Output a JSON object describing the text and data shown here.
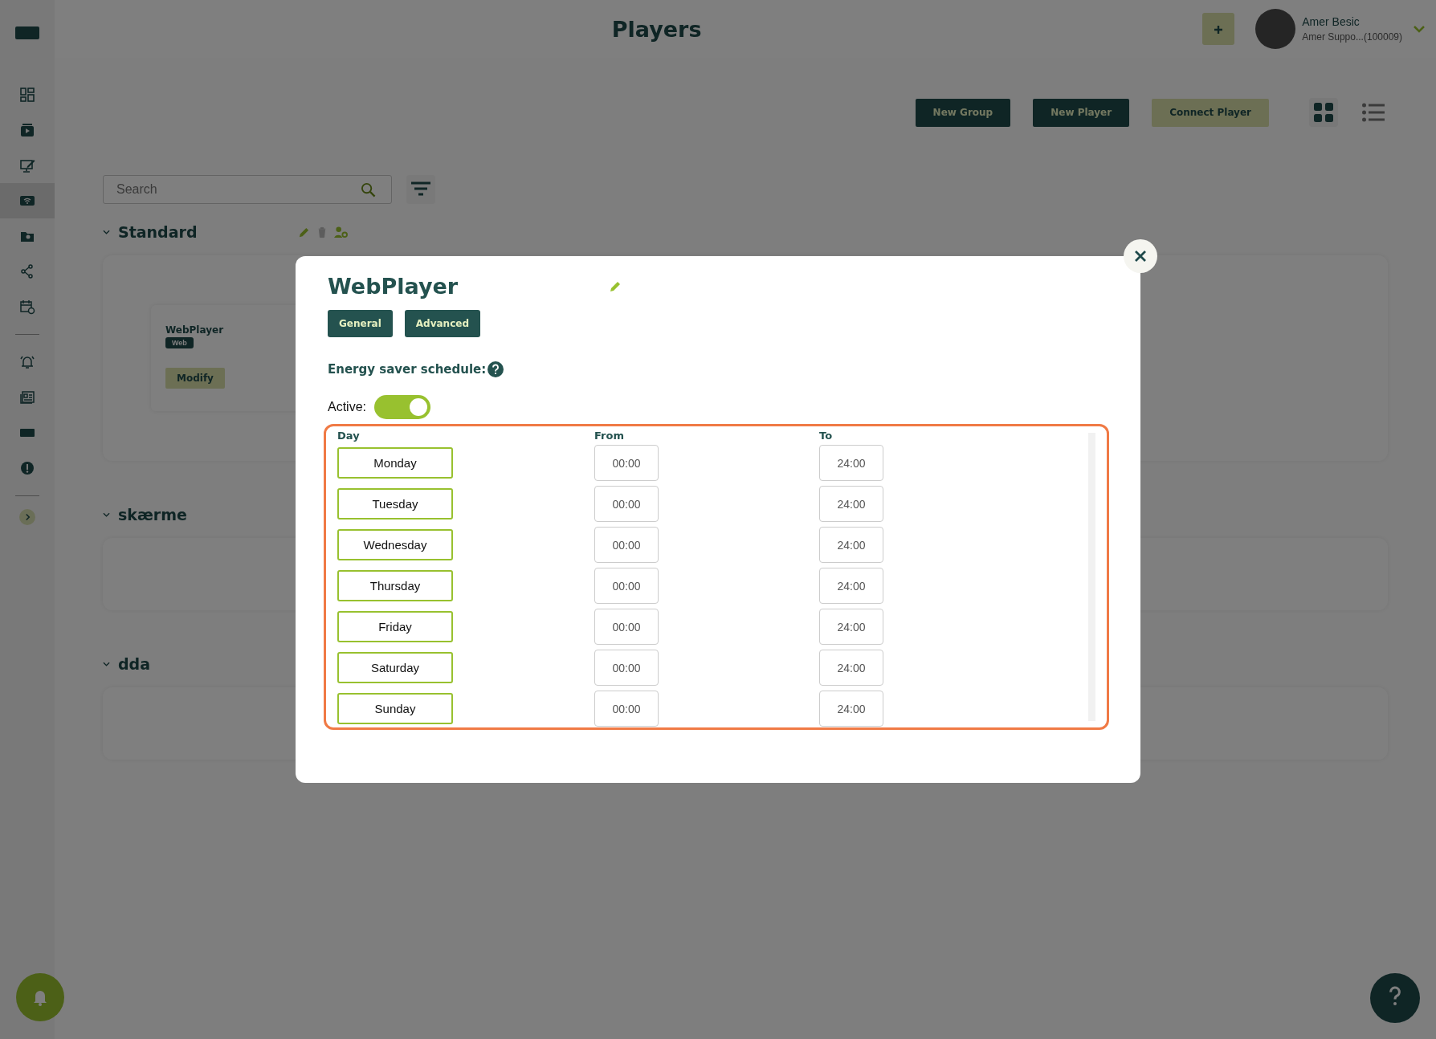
{
  "header": {
    "title": "Players",
    "user": {
      "name": "Amer Besic",
      "subtitle": "Amer Suppo...(100009)"
    }
  },
  "sidebar": {
    "sections": [
      {
        "items": [
          {
            "selected": false
          },
          {
            "selected": false
          },
          {
            "selected": false
          },
          {
            "selected": true
          },
          {
            "selected": false
          },
          {
            "selected": false
          },
          {
            "selected": false
          }
        ]
      },
      {
        "items": [
          {
            "selected": false
          },
          {
            "selected": false
          },
          {
            "selected": false
          },
          {
            "selected": false
          }
        ]
      }
    ]
  },
  "toolbar": {
    "buttons": [
      {
        "label": "New Group",
        "kind": "primary"
      },
      {
        "label": "New Player",
        "kind": "primary"
      },
      {
        "label": "Connect Player",
        "kind": "secondary"
      }
    ],
    "views": [
      {
        "kind": "grid",
        "selected": true
      },
      {
        "kind": "list",
        "selected": false
      }
    ]
  },
  "search": {
    "placeholder": "Search"
  },
  "groups": [
    {
      "name": "Standard",
      "expanded": true,
      "hovered": true,
      "players": [
        {
          "name": "WebPlayer",
          "badge": "Web",
          "action": "Modify"
        }
      ]
    },
    {
      "name": "skærme",
      "expanded": true,
      "hovered": false
    },
    {
      "name": "dda",
      "expanded": true,
      "hovered": false
    }
  ],
  "modal": {
    "title": "WebPlayer",
    "tabs": [
      {
        "label": "General"
      },
      {
        "label": "Advanced"
      }
    ],
    "section": "Energy saver schedule:",
    "active_label": "Active:",
    "active": true,
    "columns": [
      "Day",
      "From",
      "To"
    ],
    "rows": [
      {
        "day": "Monday",
        "from": "00:00",
        "to": "24:00"
      },
      {
        "day": "Tuesday",
        "from": "00:00",
        "to": "24:00"
      },
      {
        "day": "Wednesday",
        "from": "00:00",
        "to": "24:00"
      },
      {
        "day": "Thursday",
        "from": "00:00",
        "to": "24:00"
      },
      {
        "day": "Friday",
        "from": "00:00",
        "to": "24:00"
      },
      {
        "day": "Saturday",
        "from": "00:00",
        "to": "24:00"
      },
      {
        "day": "Sunday",
        "from": "00:00",
        "to": "24:00"
      }
    ]
  }
}
